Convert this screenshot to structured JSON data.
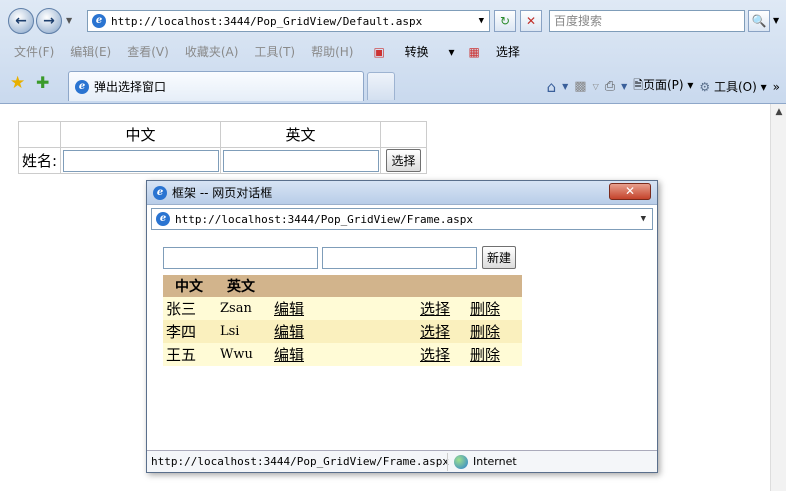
{
  "browser": {
    "address": "http://localhost:3444/Pop_GridView/Default.aspx",
    "search_placeholder": "百度搜索",
    "menu": [
      "文件(F)",
      "编辑(E)",
      "查看(V)",
      "收藏夹(A)",
      "工具(T)",
      "帮助(H)"
    ],
    "toolbar_convert": "转换",
    "toolbar_select": "选择",
    "tab_title": "弹出选择窗口",
    "tools_page": "页面(P)",
    "tools_tools": "工具(O)"
  },
  "form": {
    "header_chinese": "中文",
    "header_english": "英文",
    "name_label": "姓名:",
    "chinese_value": "",
    "english_value": "",
    "select_button": "选择"
  },
  "dialog": {
    "title": "框架 -- 网页对话框",
    "address": "http://localhost:3444/Pop_GridView/Frame.aspx",
    "input1": "",
    "input2": "",
    "new_button": "新建",
    "columns": [
      "中文",
      "英文"
    ],
    "rows": [
      {
        "chinese": "张三",
        "english": "Zsan",
        "edit": "编辑",
        "select": "选择",
        "delete": "删除"
      },
      {
        "chinese": "李四",
        "english": "Lsi",
        "edit": "编辑",
        "select": "选择",
        "delete": "删除"
      },
      {
        "chinese": "王五",
        "english": "Wwu",
        "edit": "编辑",
        "select": "选择",
        "delete": "删除"
      }
    ],
    "status_url": "http://localhost:3444/Pop_GridView/Frame.aspx",
    "status_zone": "Internet"
  },
  "colors": {
    "grid_header": "#d2b48c",
    "row_odd": "#fffbd6",
    "row_even": "#faf0be"
  }
}
